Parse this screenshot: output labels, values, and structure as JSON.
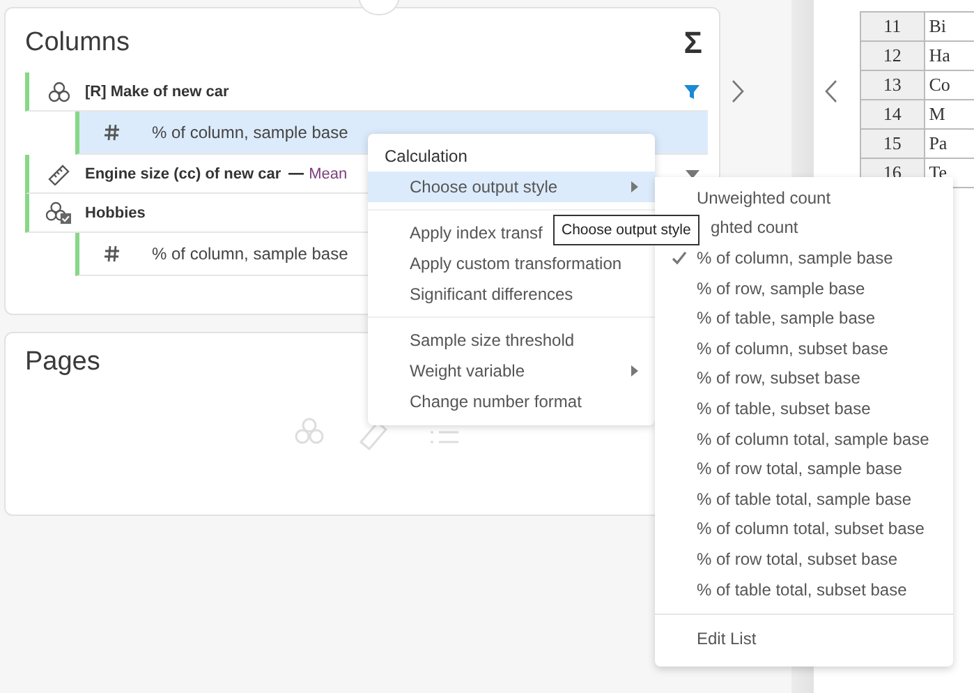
{
  "columns_panel": {
    "title": "Columns",
    "sum_icon": "Σ",
    "items": [
      {
        "kind": "categorical",
        "label": "[R] Make of new car",
        "filtered": true,
        "hovered": false,
        "children": [
          {
            "label": "% of column, sample base",
            "selected": true
          }
        ]
      },
      {
        "kind": "numeric",
        "label": "Engine size (cc) of new car",
        "statistic": "Mean",
        "filtered": false,
        "hovered": true
      },
      {
        "kind": "multi",
        "label": "Hobbies",
        "filtered": false,
        "hovered": false,
        "children": [
          {
            "label": "% of column, sample base",
            "selected": false
          }
        ]
      }
    ]
  },
  "pages_panel": {
    "title": "Pages"
  },
  "data_table": {
    "rows": [
      {
        "number": "11",
        "cell": "Bi"
      },
      {
        "number": "12",
        "cell": "Ha"
      },
      {
        "number": "13",
        "cell": "Co"
      },
      {
        "number": "14",
        "cell": "M"
      },
      {
        "number": "15",
        "cell": "Pa"
      },
      {
        "number": "16",
        "cell": "Te"
      }
    ]
  },
  "context_menu": {
    "header": "Calculation",
    "groups": [
      [
        {
          "label": "Choose output style",
          "has_submenu": true,
          "selected": true
        }
      ],
      [
        {
          "label": "Apply index transf",
          "has_submenu": false,
          "selected": false
        },
        {
          "label": "Apply custom transformation",
          "has_submenu": false,
          "selected": false
        },
        {
          "label": "Significant differences",
          "has_submenu": false,
          "selected": false
        }
      ],
      [
        {
          "label": "Sample size threshold",
          "has_submenu": false,
          "selected": false
        },
        {
          "label": "Weight variable",
          "has_submenu": true,
          "selected": false
        },
        {
          "label": "Change number format",
          "has_submenu": false,
          "selected": false
        }
      ]
    ]
  },
  "submenu": {
    "items": [
      {
        "label": "Unweighted count",
        "checked": false
      },
      {
        "label": "ghted count",
        "checked": false
      },
      {
        "label": "% of column, sample base",
        "checked": true
      },
      {
        "label": "% of row, sample base",
        "checked": false
      },
      {
        "label": "% of table, sample base",
        "checked": false
      },
      {
        "label": "% of column, subset base",
        "checked": false
      },
      {
        "label": "% of row, subset base",
        "checked": false
      },
      {
        "label": "% of table, subset base",
        "checked": false
      },
      {
        "label": "% of column total, sample base",
        "checked": false
      },
      {
        "label": "% of row total, sample base",
        "checked": false
      },
      {
        "label": "% of table total, sample base",
        "checked": false
      },
      {
        "label": "% of column total, subset base",
        "checked": false
      },
      {
        "label": "% of row total, subset base",
        "checked": false
      },
      {
        "label": "% of table total, subset base",
        "checked": false
      }
    ],
    "footer": "Edit List"
  },
  "tooltip": "Choose output style"
}
